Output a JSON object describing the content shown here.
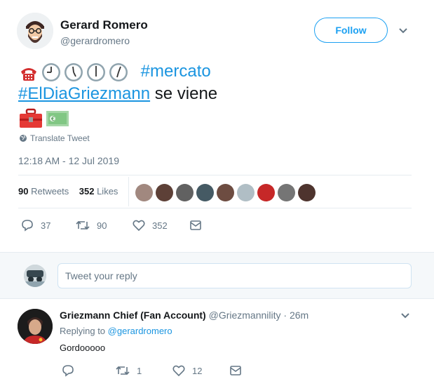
{
  "tweet": {
    "author_name": "Gerard Romero",
    "author_handle": "@gerardromero",
    "follow_label": "Follow",
    "line1_hashtag": "#mercato",
    "line2_hashtag": "#ElDiaGriezmann",
    "line2_text": " se viene",
    "translate_label": "Translate Tweet",
    "timestamp": "12:18 AM - 12 Jul 2019",
    "retweets_count": "90",
    "retweets_label": "Retweets",
    "likes_count": "352",
    "likes_label": "Likes",
    "actions": {
      "reply_count": "37",
      "retweet_count": "90",
      "like_count": "352"
    },
    "liker_colors": [
      "#a1887f",
      "#5d4037",
      "#616161",
      "#455a64",
      "#6d4c41",
      "#b0bec5",
      "#c62828",
      "#757575",
      "#4e342e"
    ]
  },
  "reply_box": {
    "placeholder": "Tweet your reply"
  },
  "reply": {
    "author_name": "Griezmann Chief (Fan Account)",
    "author_handle": "@Griezmannility",
    "time": "· 26m",
    "replying_prefix": "Replying to ",
    "replying_to": "@gerardromero",
    "text": "Gordooooo",
    "actions": {
      "retweet_count": "1",
      "like_count": "12"
    }
  },
  "icons": [
    "telephone-icon",
    "clock-icon",
    "toolbox-icon",
    "euro-banknote-icon",
    "globe-icon",
    "reply-icon",
    "retweet-icon",
    "heart-icon",
    "message-icon",
    "chevron-down-icon"
  ],
  "colors": {
    "accent": "#1da1f2",
    "link": "#1b95e0",
    "muted": "#657786",
    "text": "#14171a"
  }
}
